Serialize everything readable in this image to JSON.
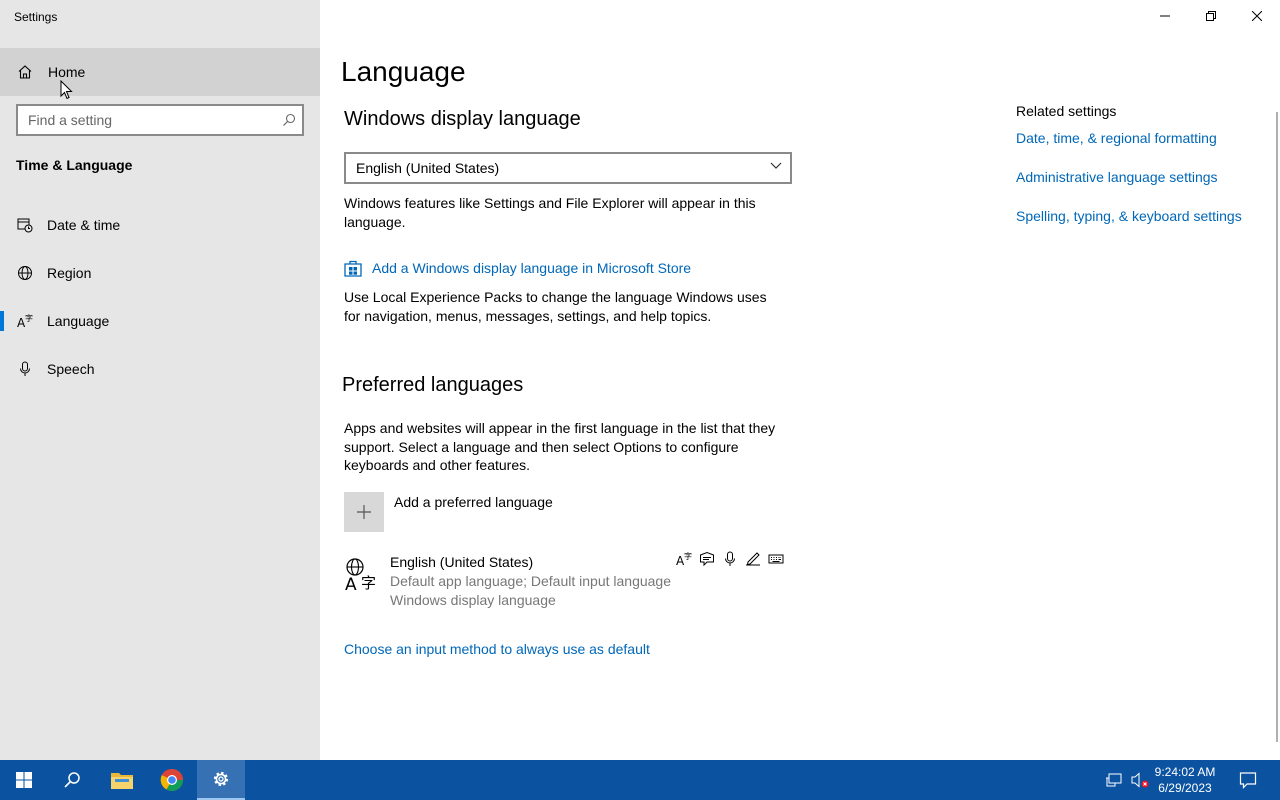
{
  "window": {
    "title": "Settings",
    "controls": [
      "minimize",
      "restore",
      "close"
    ]
  },
  "sidebar": {
    "home_label": "Home",
    "search_placeholder": "Find a setting",
    "section_heading": "Time & Language",
    "items": [
      {
        "label": "Date & time",
        "icon": "calendar-clock-icon",
        "active": false
      },
      {
        "label": "Region",
        "icon": "globe-icon",
        "active": false
      },
      {
        "label": "Language",
        "icon": "language-icon",
        "active": true
      },
      {
        "label": "Speech",
        "icon": "microphone-icon",
        "active": false
      }
    ]
  },
  "main": {
    "page_title": "Language",
    "display_language": {
      "heading": "Windows display language",
      "selected": "English (United States)",
      "description": "Windows features like Settings and File Explorer will appear in this language.",
      "store_link": "Add a Windows display language in Microsoft Store",
      "store_description": "Use Local Experience Packs to change the language Windows uses for navigation, menus, messages, settings, and help topics."
    },
    "preferred": {
      "heading": "Preferred languages",
      "description": "Apps and websites will appear in the first language in the list that they support. Select a language and then select Options to configure keyboards and other features.",
      "add_label": "Add a preferred language",
      "entry": {
        "name": "English (United States)",
        "detail1": "Default app language; Default input language",
        "detail2": "Windows display language",
        "feature_icons": [
          "display-language-icon",
          "speech-bubble-icon",
          "microphone-icon",
          "handwriting-icon",
          "keyboard-icon"
        ]
      },
      "input_method_link": "Choose an input method to always use as default"
    },
    "related": {
      "heading": "Related settings",
      "links": [
        "Date, time, & regional formatting",
        "Administrative language settings",
        "Spelling, typing, & keyboard settings"
      ]
    }
  },
  "taskbar": {
    "time": "9:24:02 AM",
    "date": "6/29/2023",
    "apps": [
      "start-icon",
      "search-icon",
      "file-explorer-icon",
      "chrome-icon",
      "settings-icon"
    ],
    "tray": [
      "network-icon",
      "volume-muted-icon",
      "notifications-icon"
    ]
  },
  "colors": {
    "accent": "#0078d7",
    "link": "#0067b8",
    "sidebar_bg": "#e6e6e6",
    "taskbar_bg": "#0b53a0"
  }
}
